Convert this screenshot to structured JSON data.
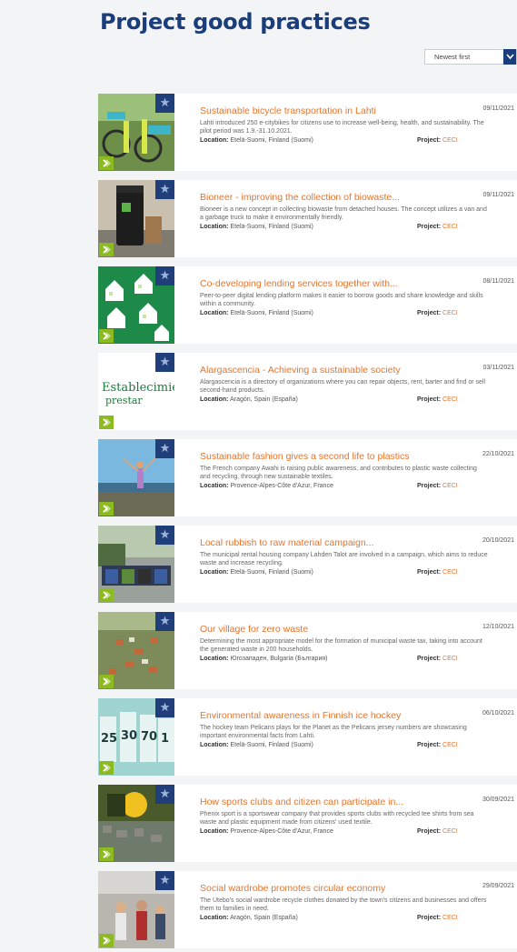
{
  "page": {
    "title": "Project good practices",
    "sort": {
      "selected": "Newest first"
    }
  },
  "labels": {
    "location": "Location:",
    "project": "Project:"
  },
  "colors": {
    "title": "#1a3d7c",
    "accent": "#e8742b",
    "badge_blue": "#203f7a",
    "badge_green": "#8cbb1f"
  },
  "cards": [
    {
      "title": "Sustainable bicycle transportation in Lahti",
      "date": "09/11/2021",
      "description": "Lahti introduced 250 e-citybikes for citizens use to increase well-being, health, and sustainability. The pilot period was 1.9.-31.10.2021.",
      "location": "Etelä-Suomi, Finland (Suomi)",
      "project": "CECI"
    },
    {
      "title": "Bioneer - improving the collection of biowaste...",
      "date": "09/11/2021",
      "description": "Bioneer is a new concept in collecting biowaste from detached houses. The concept utilizes a van and a garbage truck to make it environmentally friendly.",
      "location": "Etelä-Suomi, Finland (Suomi)",
      "project": "CECI"
    },
    {
      "title": "Co-developing lending services together with...",
      "date": "08/11/2021",
      "description": "Peer-to-peer digital lending platform makes it easier to borrow goods and share knowledge and skills within a community.",
      "location": "Etelä-Suomi, Finland (Suomi)",
      "project": "CECI"
    },
    {
      "title": "Alargascencia - Achieving a sustainable society",
      "date": "03/11/2021",
      "description": "Alargascencia is a directory of organizations where you can repair objects, rent, barter and find or sell second-hand products.",
      "location": "Aragón, Spain (España)",
      "project": "CECI"
    },
    {
      "title": "Sustainable fashion gives a second life to plastics",
      "date": "22/10/2021",
      "description": "The French company Awahi is raising public awareness, and contributes to plastic waste collecting and recycling, through new sustainable textiles.",
      "location": "Provence-Alpes-Côte d'Azur, France",
      "project": "CECI"
    },
    {
      "title": "Local rubbish to raw material campaign...",
      "date": "20/10/2021",
      "description": "The municipal rental housing company Lahden Talot are involved in a campaign, which aims to reduce waste and increase recycling.",
      "location": "Etelä-Suomi, Finland (Suomi)",
      "project": "CECI"
    },
    {
      "title": "Our village for zero waste",
      "date": "12/10/2021",
      "description": "Determining the most appropriate model for the formation of municipal waste tax, taking into account the generated waste in 200 households.",
      "location": "Югозападен, Bulgaria (България)",
      "project": "CECI"
    },
    {
      "title": "Environmental awareness in Finnish ice hockey",
      "date": "06/10/2021",
      "description": "The hockey team Pelicans plays for the Planet as the Pelicans jersey numbers are showcasing important environmental facts from Lahti.",
      "location": "Etelä-Suomi, Finland (Suomi)",
      "project": "CECI"
    },
    {
      "title": "How sports clubs and citizen can participate in...",
      "date": "30/09/2021",
      "description": "Phenix sport is a sportswear company that provides sports clubs with recycled tee shirts from sea waste and plastic equipment made from citizens' used textile.",
      "location": "Provence-Alpes-Côte d'Azur, France",
      "project": "CECI"
    },
    {
      "title": "Social wardrobe promotes circular economy",
      "date": "29/09/2021",
      "description": "The Utebo's social wardrobe recycle clothes donated by the town's citizens and businesses and offers them to families in need.",
      "location": "Aragón, Spain (España)",
      "project": "CECI"
    }
  ]
}
